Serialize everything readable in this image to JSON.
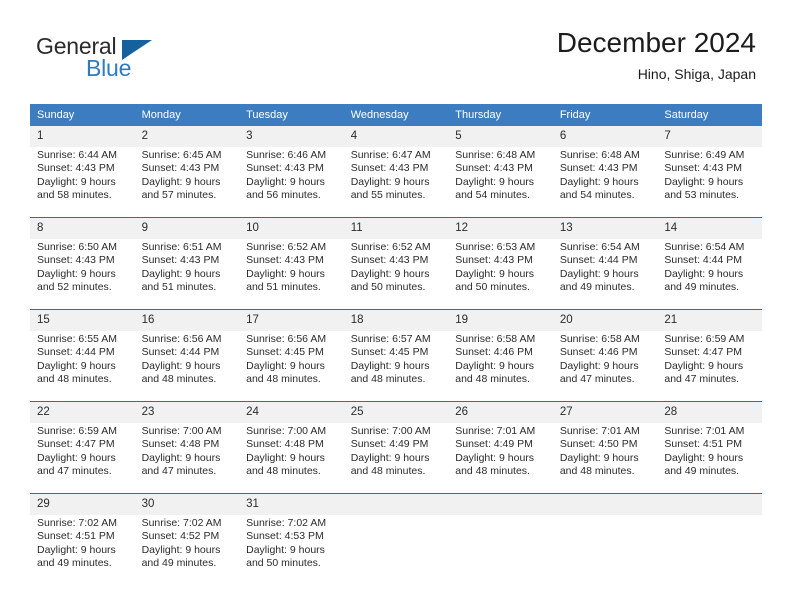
{
  "brand": {
    "name_part1": "General",
    "name_part2": "Blue",
    "triangle_color": "#15619E",
    "blue_color": "#2E7BC4"
  },
  "header": {
    "title": "December 2024",
    "location": "Hino, Shiga, Japan"
  },
  "theme": {
    "header_blue": "#3B7DC0",
    "row_divider_blue": "#2E6DAE",
    "daynum_band": "#F1F1F1"
  },
  "weekdays": [
    "Sunday",
    "Monday",
    "Tuesday",
    "Wednesday",
    "Thursday",
    "Friday",
    "Saturday"
  ],
  "weeks": [
    [
      {
        "day": "1",
        "sunrise": "Sunrise: 6:44 AM",
        "sunset": "Sunset: 4:43 PM",
        "daylight1": "Daylight: 9 hours",
        "daylight2": "and 58 minutes."
      },
      {
        "day": "2",
        "sunrise": "Sunrise: 6:45 AM",
        "sunset": "Sunset: 4:43 PM",
        "daylight1": "Daylight: 9 hours",
        "daylight2": "and 57 minutes."
      },
      {
        "day": "3",
        "sunrise": "Sunrise: 6:46 AM",
        "sunset": "Sunset: 4:43 PM",
        "daylight1": "Daylight: 9 hours",
        "daylight2": "and 56 minutes."
      },
      {
        "day": "4",
        "sunrise": "Sunrise: 6:47 AM",
        "sunset": "Sunset: 4:43 PM",
        "daylight1": "Daylight: 9 hours",
        "daylight2": "and 55 minutes."
      },
      {
        "day": "5",
        "sunrise": "Sunrise: 6:48 AM",
        "sunset": "Sunset: 4:43 PM",
        "daylight1": "Daylight: 9 hours",
        "daylight2": "and 54 minutes."
      },
      {
        "day": "6",
        "sunrise": "Sunrise: 6:48 AM",
        "sunset": "Sunset: 4:43 PM",
        "daylight1": "Daylight: 9 hours",
        "daylight2": "and 54 minutes."
      },
      {
        "day": "7",
        "sunrise": "Sunrise: 6:49 AM",
        "sunset": "Sunset: 4:43 PM",
        "daylight1": "Daylight: 9 hours",
        "daylight2": "and 53 minutes."
      }
    ],
    [
      {
        "day": "8",
        "sunrise": "Sunrise: 6:50 AM",
        "sunset": "Sunset: 4:43 PM",
        "daylight1": "Daylight: 9 hours",
        "daylight2": "and 52 minutes."
      },
      {
        "day": "9",
        "sunrise": "Sunrise: 6:51 AM",
        "sunset": "Sunset: 4:43 PM",
        "daylight1": "Daylight: 9 hours",
        "daylight2": "and 51 minutes."
      },
      {
        "day": "10",
        "sunrise": "Sunrise: 6:52 AM",
        "sunset": "Sunset: 4:43 PM",
        "daylight1": "Daylight: 9 hours",
        "daylight2": "and 51 minutes."
      },
      {
        "day": "11",
        "sunrise": "Sunrise: 6:52 AM",
        "sunset": "Sunset: 4:43 PM",
        "daylight1": "Daylight: 9 hours",
        "daylight2": "and 50 minutes."
      },
      {
        "day": "12",
        "sunrise": "Sunrise: 6:53 AM",
        "sunset": "Sunset: 4:43 PM",
        "daylight1": "Daylight: 9 hours",
        "daylight2": "and 50 minutes."
      },
      {
        "day": "13",
        "sunrise": "Sunrise: 6:54 AM",
        "sunset": "Sunset: 4:44 PM",
        "daylight1": "Daylight: 9 hours",
        "daylight2": "and 49 minutes."
      },
      {
        "day": "14",
        "sunrise": "Sunrise: 6:54 AM",
        "sunset": "Sunset: 4:44 PM",
        "daylight1": "Daylight: 9 hours",
        "daylight2": "and 49 minutes."
      }
    ],
    [
      {
        "day": "15",
        "sunrise": "Sunrise: 6:55 AM",
        "sunset": "Sunset: 4:44 PM",
        "daylight1": "Daylight: 9 hours",
        "daylight2": "and 48 minutes."
      },
      {
        "day": "16",
        "sunrise": "Sunrise: 6:56 AM",
        "sunset": "Sunset: 4:44 PM",
        "daylight1": "Daylight: 9 hours",
        "daylight2": "and 48 minutes."
      },
      {
        "day": "17",
        "sunrise": "Sunrise: 6:56 AM",
        "sunset": "Sunset: 4:45 PM",
        "daylight1": "Daylight: 9 hours",
        "daylight2": "and 48 minutes."
      },
      {
        "day": "18",
        "sunrise": "Sunrise: 6:57 AM",
        "sunset": "Sunset: 4:45 PM",
        "daylight1": "Daylight: 9 hours",
        "daylight2": "and 48 minutes."
      },
      {
        "day": "19",
        "sunrise": "Sunrise: 6:58 AM",
        "sunset": "Sunset: 4:46 PM",
        "daylight1": "Daylight: 9 hours",
        "daylight2": "and 48 minutes."
      },
      {
        "day": "20",
        "sunrise": "Sunrise: 6:58 AM",
        "sunset": "Sunset: 4:46 PM",
        "daylight1": "Daylight: 9 hours",
        "daylight2": "and 47 minutes."
      },
      {
        "day": "21",
        "sunrise": "Sunrise: 6:59 AM",
        "sunset": "Sunset: 4:47 PM",
        "daylight1": "Daylight: 9 hours",
        "daylight2": "and 47 minutes."
      }
    ],
    [
      {
        "day": "22",
        "sunrise": "Sunrise: 6:59 AM",
        "sunset": "Sunset: 4:47 PM",
        "daylight1": "Daylight: 9 hours",
        "daylight2": "and 47 minutes."
      },
      {
        "day": "23",
        "sunrise": "Sunrise: 7:00 AM",
        "sunset": "Sunset: 4:48 PM",
        "daylight1": "Daylight: 9 hours",
        "daylight2": "and 47 minutes."
      },
      {
        "day": "24",
        "sunrise": "Sunrise: 7:00 AM",
        "sunset": "Sunset: 4:48 PM",
        "daylight1": "Daylight: 9 hours",
        "daylight2": "and 48 minutes."
      },
      {
        "day": "25",
        "sunrise": "Sunrise: 7:00 AM",
        "sunset": "Sunset: 4:49 PM",
        "daylight1": "Daylight: 9 hours",
        "daylight2": "and 48 minutes."
      },
      {
        "day": "26",
        "sunrise": "Sunrise: 7:01 AM",
        "sunset": "Sunset: 4:49 PM",
        "daylight1": "Daylight: 9 hours",
        "daylight2": "and 48 minutes."
      },
      {
        "day": "27",
        "sunrise": "Sunrise: 7:01 AM",
        "sunset": "Sunset: 4:50 PM",
        "daylight1": "Daylight: 9 hours",
        "daylight2": "and 48 minutes."
      },
      {
        "day": "28",
        "sunrise": "Sunrise: 7:01 AM",
        "sunset": "Sunset: 4:51 PM",
        "daylight1": "Daylight: 9 hours",
        "daylight2": "and 49 minutes."
      }
    ],
    [
      {
        "day": "29",
        "sunrise": "Sunrise: 7:02 AM",
        "sunset": "Sunset: 4:51 PM",
        "daylight1": "Daylight: 9 hours",
        "daylight2": "and 49 minutes."
      },
      {
        "day": "30",
        "sunrise": "Sunrise: 7:02 AM",
        "sunset": "Sunset: 4:52 PM",
        "daylight1": "Daylight: 9 hours",
        "daylight2": "and 49 minutes."
      },
      {
        "day": "31",
        "sunrise": "Sunrise: 7:02 AM",
        "sunset": "Sunset: 4:53 PM",
        "daylight1": "Daylight: 9 hours",
        "daylight2": "and 50 minutes."
      },
      {
        "day": "",
        "sunrise": "",
        "sunset": "",
        "daylight1": "",
        "daylight2": ""
      },
      {
        "day": "",
        "sunrise": "",
        "sunset": "",
        "daylight1": "",
        "daylight2": ""
      },
      {
        "day": "",
        "sunrise": "",
        "sunset": "",
        "daylight1": "",
        "daylight2": ""
      },
      {
        "day": "",
        "sunrise": "",
        "sunset": "",
        "daylight1": "",
        "daylight2": ""
      }
    ]
  ]
}
